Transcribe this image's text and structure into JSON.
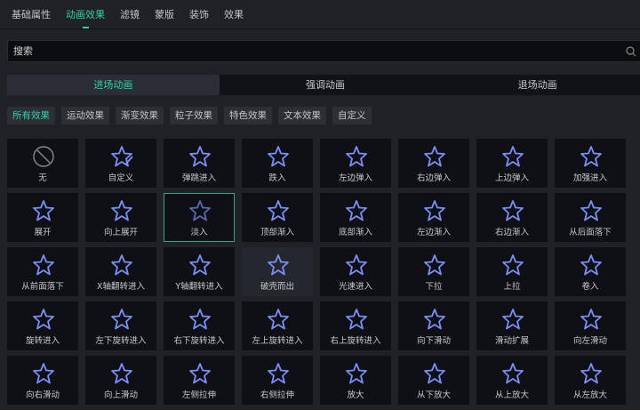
{
  "top_tabs": [
    {
      "label": "基础属性"
    },
    {
      "label": "动画效果",
      "active": true
    },
    {
      "label": "滤镜"
    },
    {
      "label": "蒙版"
    },
    {
      "label": "装饰"
    },
    {
      "label": "效果"
    }
  ],
  "search": {
    "placeholder": "搜索",
    "icon": "search-icon"
  },
  "segments": [
    {
      "label": "进场动画",
      "active": true
    },
    {
      "label": "强调动画"
    },
    {
      "label": "退场动画"
    }
  ],
  "filters": [
    {
      "label": "所有效果",
      "active": true
    },
    {
      "label": "运动效果"
    },
    {
      "label": "渐变效果"
    },
    {
      "label": "粒子效果"
    },
    {
      "label": "特色效果"
    },
    {
      "label": "文本效果"
    },
    {
      "label": "自定义"
    }
  ],
  "colors": {
    "accent": "#2fd3a3",
    "icon": "#7b8ff5"
  },
  "effects": [
    {
      "label": "无",
      "icon": "none-icon"
    },
    {
      "label": "自定义",
      "icon": "star-edit-icon"
    },
    {
      "label": "弹跳进入",
      "icon": "star-icon"
    },
    {
      "label": "跌入",
      "icon": "star-icon"
    },
    {
      "label": "左边弹入",
      "icon": "star-icon"
    },
    {
      "label": "右边弹入",
      "icon": "star-icon"
    },
    {
      "label": "上边弹入",
      "icon": "star-icon"
    },
    {
      "label": "加强进入",
      "icon": "star-icon"
    },
    {
      "label": "展开",
      "icon": "star-icon"
    },
    {
      "label": "向上展开",
      "icon": "star-icon"
    },
    {
      "label": "淡入",
      "icon": "star-icon",
      "selected": true
    },
    {
      "label": "顶部渐入",
      "icon": "star-icon"
    },
    {
      "label": "底部渐入",
      "icon": "star-icon"
    },
    {
      "label": "左边渐入",
      "icon": "star-icon"
    },
    {
      "label": "右边渐入",
      "icon": "star-icon"
    },
    {
      "label": "从后面落下",
      "icon": "star-icon"
    },
    {
      "label": "从前面落下",
      "icon": "star-icon"
    },
    {
      "label": "X轴翻转进入",
      "icon": "star-icon"
    },
    {
      "label": "Y轴翻转进入",
      "icon": "star-icon"
    },
    {
      "label": "破壳而出",
      "icon": "star-icon",
      "hover": true
    },
    {
      "label": "光速进入",
      "icon": "star-icon"
    },
    {
      "label": "下拉",
      "icon": "star-icon"
    },
    {
      "label": "上拉",
      "icon": "star-icon"
    },
    {
      "label": "卷入",
      "icon": "star-icon"
    },
    {
      "label": "旋转进入",
      "icon": "star-icon"
    },
    {
      "label": "左下旋转进入",
      "icon": "star-icon"
    },
    {
      "label": "右下旋转进入",
      "icon": "star-icon"
    },
    {
      "label": "左上旋转进入",
      "icon": "star-icon"
    },
    {
      "label": "右上旋转进入",
      "icon": "star-icon"
    },
    {
      "label": "向下滑动",
      "icon": "star-icon"
    },
    {
      "label": "滑动扩展",
      "icon": "star-icon"
    },
    {
      "label": "向左滑动",
      "icon": "star-icon"
    },
    {
      "label": "向右滑动",
      "icon": "star-icon"
    },
    {
      "label": "向上滑动",
      "icon": "star-icon"
    },
    {
      "label": "左侧拉伸",
      "icon": "star-icon"
    },
    {
      "label": "右侧拉伸",
      "icon": "star-icon"
    },
    {
      "label": "放大",
      "icon": "star-icon"
    },
    {
      "label": "从下放大",
      "icon": "star-icon"
    },
    {
      "label": "从上放大",
      "icon": "star-icon"
    },
    {
      "label": "从左放大",
      "icon": "star-icon"
    }
  ]
}
